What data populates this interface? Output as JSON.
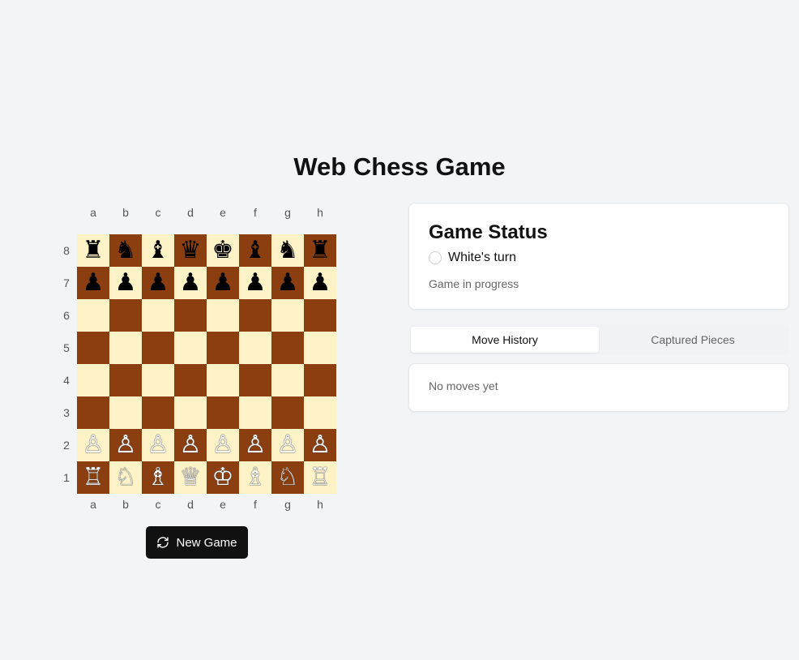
{
  "title": "Web Chess Game",
  "board": {
    "files": [
      "a",
      "b",
      "c",
      "d",
      "e",
      "f",
      "g",
      "h"
    ],
    "ranks": [
      "8",
      "7",
      "6",
      "5",
      "4",
      "3",
      "2",
      "1"
    ],
    "colors": {
      "light": "#fef3c7",
      "dark": "#8b3f10"
    },
    "position": [
      [
        "♜",
        "♞",
        "♝",
        "♛",
        "♚",
        "♝",
        "♞",
        "♜"
      ],
      [
        "♟",
        "♟",
        "♟",
        "♟",
        "♟",
        "♟",
        "♟",
        "♟"
      ],
      [
        "",
        "",
        "",
        "",
        "",
        "",
        "",
        ""
      ],
      [
        "",
        "",
        "",
        "",
        "",
        "",
        "",
        ""
      ],
      [
        "",
        "",
        "",
        "",
        "",
        "",
        "",
        ""
      ],
      [
        "",
        "",
        "",
        "",
        "",
        "",
        "",
        ""
      ],
      [
        "♙",
        "♙",
        "♙",
        "♙",
        "♙",
        "♙",
        "♙",
        "♙"
      ],
      [
        "♖",
        "♘",
        "♗",
        "♕",
        "♔",
        "♗",
        "♘",
        "♖"
      ]
    ]
  },
  "controls": {
    "new_game_label": "New Game",
    "new_game_icon": "refresh-icon"
  },
  "status": {
    "heading": "Game Status",
    "turn_text": "White's turn",
    "state_text": "Game in progress"
  },
  "tabs": [
    {
      "label": "Move History",
      "active": true
    },
    {
      "label": "Captured Pieces",
      "active": false
    }
  ],
  "history": {
    "empty_text": "No moves yet"
  }
}
